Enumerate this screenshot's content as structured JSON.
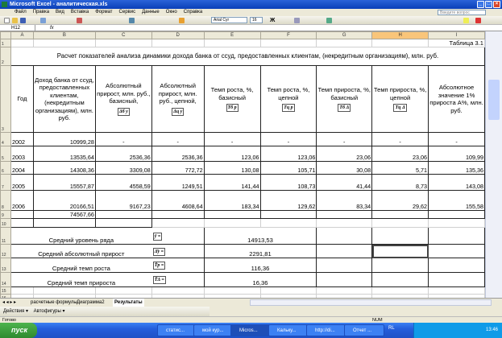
{
  "window": {
    "title": "Microsoft Excel - аналитическая.xls"
  },
  "menu": [
    "Файл",
    "Правка",
    "Вид",
    "Вставка",
    "Формат",
    "Сервис",
    "Данные",
    "Окно",
    "Справка"
  ],
  "ask_placeholder": "Введите вопрос",
  "toolbar": {
    "font": "Arial Cyr",
    "size": "16"
  },
  "formula_bar": {
    "name_box": "H12",
    "fx": "fx"
  },
  "columns": [
    "A",
    "B",
    "C",
    "D",
    "E",
    "F",
    "G",
    "H",
    "I"
  ],
  "rows": [
    "1",
    "2",
    "3",
    "4",
    "5",
    "6",
    "7",
    "8",
    "9",
    "10",
    "11",
    "12",
    "13",
    "14",
    "15",
    "16"
  ],
  "sheet": {
    "table_no": "Таблица 3.1",
    "title": "Расчет показателей анализа динамики дохода банка от ссуд, предоставленных клиентам, (некредитным организациям), млн. руб.",
    "headers": [
      "Год",
      "Доход банка от ссуд, предоставленных клиентам, (некредитным организациям), млн. руб.",
      "Абсолютный прирост, млн. руб., базисный,",
      "Абсолютный прирост, млн. руб., цепной,",
      "Темп роста, %, базисный",
      "Темп роста, %, цепной",
      "Темп прироста, %, базисный",
      "Темп прироста, %, цепной",
      "Абсолютное значение 1% прироста А%, млн. руб."
    ],
    "header_symbols": [
      "",
      "",
      "Δб y",
      "Δц y",
      "Tб p",
      "Tц p",
      "Tб Δ",
      "Tц Δ",
      ""
    ],
    "data": [
      [
        "2002",
        "10999,28",
        "-",
        "-",
        "-",
        "-",
        "-",
        "-",
        "-"
      ],
      [
        "2003",
        "13535,64",
        "2536,36",
        "2536,36",
        "123,06",
        "123,06",
        "23,06",
        "23,06",
        "109,99"
      ],
      [
        "2004",
        "14308,36",
        "3309,08",
        "772,72",
        "130,08",
        "105,71",
        "30,08",
        "5,71",
        "135,36"
      ],
      [
        "2005",
        "15557,87",
        "4558,59",
        "1249,51",
        "141,44",
        "108,73",
        "41,44",
        "8,73",
        "143,08"
      ],
      [
        "2006",
        "20166,51",
        "9167,23",
        "4608,64",
        "183,34",
        "129,62",
        "83,34",
        "29,62",
        "155,58"
      ]
    ],
    "total": "74567,66",
    "summary": [
      {
        "label": "Средний уровень ряда",
        "symbol": "ȳ =",
        "value": "14913,53"
      },
      {
        "label": "Средний абсолютный прирост",
        "symbol": "Δ̄y =",
        "value": "2291,81"
      },
      {
        "label": "Средний темп роста",
        "symbol": "T̄p =",
        "value": "116,36"
      },
      {
        "label": "Средний темп прироста",
        "symbol": "T̄Δ =",
        "value": "16,36"
      }
    ]
  },
  "sheet_tabs": [
    "расчетные формулы",
    "Диаграмма2",
    "Результаты"
  ],
  "drawing": {
    "actions": "Действия ▾",
    "autoshapes": "Автофигуры ▾"
  },
  "status": {
    "ready": "Готово",
    "num": "NUM"
  },
  "taskbar": {
    "start": "пуск",
    "tasks": [
      "статис...",
      "мой кур...",
      "Micros...",
      "Кальку...",
      "http://di...",
      "Отчет ..."
    ],
    "lang": "RL",
    "clock": "13:46"
  }
}
